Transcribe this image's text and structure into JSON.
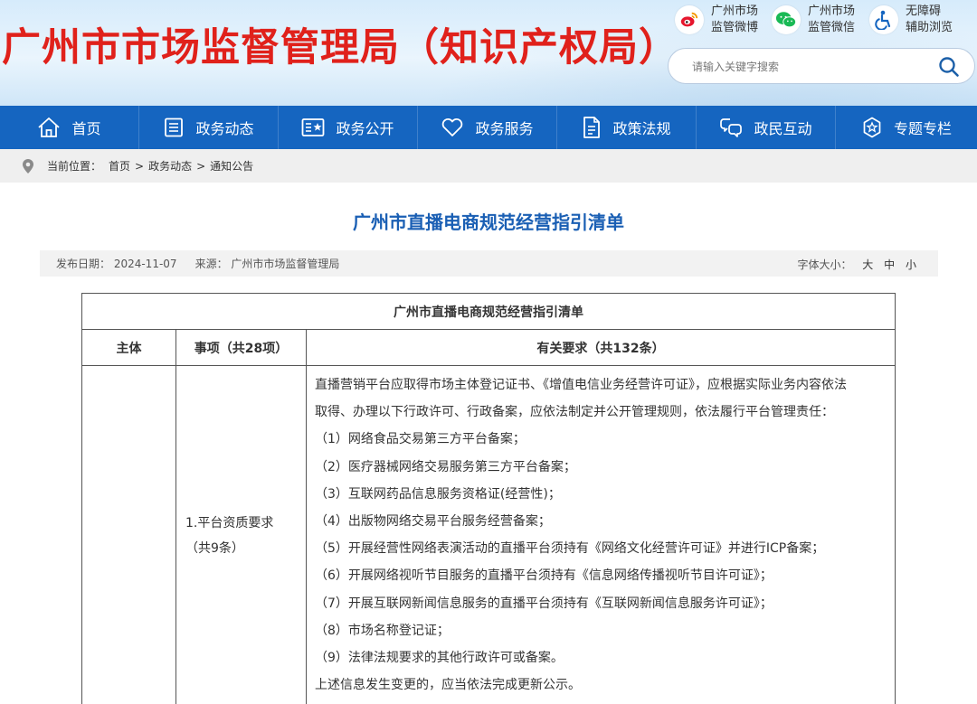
{
  "header": {
    "site_title": "广州市市场监督管理局（知识产权局）",
    "quick_links": [
      {
        "icon": "weibo-icon",
        "line1": "广州市场",
        "line2": "监管微博"
      },
      {
        "icon": "wechat-icon",
        "line1": "广州市场",
        "line2": "监管微信"
      },
      {
        "icon": "accessibility-icon",
        "line1": "无障碍",
        "line2": "辅助浏览"
      }
    ],
    "search_placeholder": "请输入关键字搜索"
  },
  "nav": [
    {
      "icon": "home-icon",
      "label": "首页"
    },
    {
      "icon": "news-icon",
      "label": "政务动态"
    },
    {
      "icon": "disclosure-icon",
      "label": "政务公开"
    },
    {
      "icon": "heart-icon",
      "label": "政务服务"
    },
    {
      "icon": "document-icon",
      "label": "政策法规"
    },
    {
      "icon": "interaction-icon",
      "label": "政民互动"
    },
    {
      "icon": "topic-icon",
      "label": "专题专栏"
    }
  ],
  "breadcrumb": {
    "prefix": "当前位置：",
    "items": [
      "首页",
      "政务动态",
      "通知公告"
    ]
  },
  "article": {
    "title": "广州市直播电商规范经营指引清单",
    "publish_date": "发布日期：  2024-11-07",
    "source": "来源：  广州市市场监督管理局",
    "font_size_label": "字体大小：",
    "font_sizes": [
      "大",
      "中",
      "小"
    ]
  },
  "table": {
    "caption": "广州市直播电商规范经营指引清单",
    "headers": [
      "主体",
      "事项（共28项）",
      "有关要求（共132条）"
    ],
    "row1": {
      "subject": "",
      "item_line1": "1.平台资质要求",
      "item_line2": "（共9条）",
      "requirements": [
        "直播营销平台应取得市场主体登记证书、《增值电信业务经营许可证》，应根据实际业务内容依法",
        "取得、办理以下行政许可、行政备案，应依法制定并公开管理规则，依法履行平台管理责任：",
        "（1）网络食品交易第三方平台备案；",
        "（2）医疗器械网络交易服务第三方平台备案；",
        "（3）互联网药品信息服务资格证(经营性)；",
        "（4）出版物网络交易平台服务经营备案；",
        "（5）开展经营性网络表演活动的直播平台须持有《网络文化经营许可证》并进行ICP备案；",
        "（6）开展网络视听节目服务的直播平台须持有《信息网络传播视听节目许可证》；",
        "（7）开展互联网新闻信息服务的直播平台须持有《互联网新闻信息服务许可证》；",
        "（8）市场名称登记证；",
        "（9）法律法规要求的其他行政许可或备案。",
        "上述信息发生变更的，应当依法完成更新公示。"
      ]
    }
  },
  "colors": {
    "title_red": "#e0211b",
    "nav_blue": "#1565c0",
    "article_title_blue": "#1a5fb4"
  }
}
